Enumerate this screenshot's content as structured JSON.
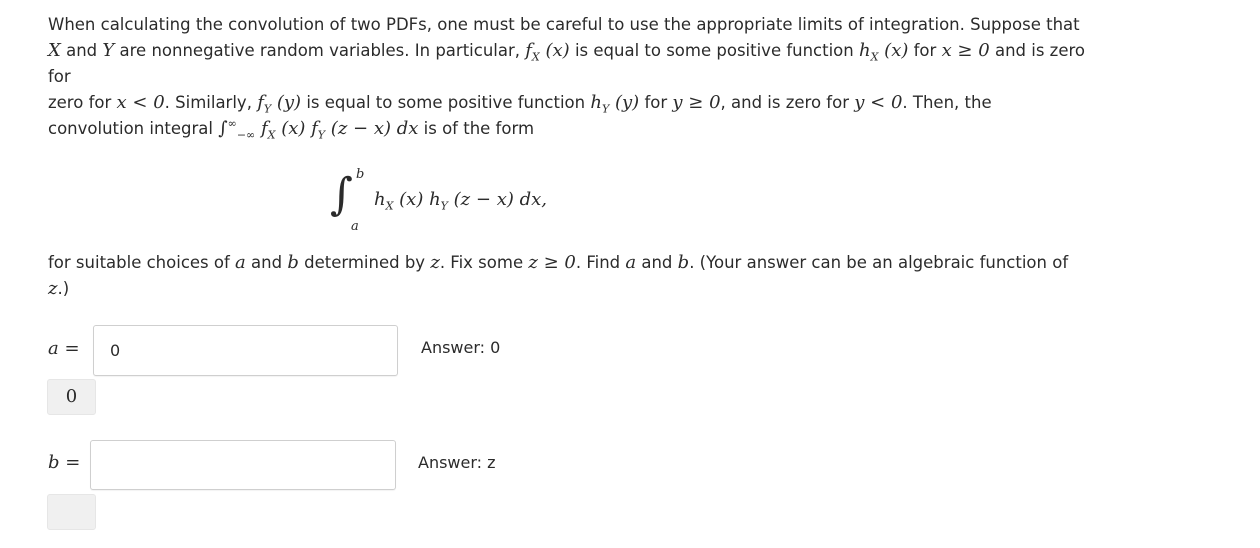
{
  "problem": {
    "p1_t1": "When calculating the convolution of two PDFs, one must be careful to use the appropriate limits of integration. Suppose that",
    "X": "X",
    "and": "and",
    "Y": "Y",
    "t2": "are nonnegative random variables. In particular,",
    "fX": "f",
    "subX": "X",
    "argx": "(x)",
    "t3": "is equal to some positive function",
    "hX": "h",
    "t4": "for",
    "cond_x": "x ≥ 0",
    "t5": "and is zero for",
    "cond_x_neg": "x < 0",
    "t6": ". Similarly,",
    "fY": "f",
    "subY": "Y",
    "argy": "(y)",
    "t7": "is equal to some positive function",
    "hY": "h",
    "t8": "for",
    "cond_y": "y ≥ 0",
    "t9": ", and is zero for",
    "cond_y_neg": "y < 0",
    "t10": ". Then, the",
    "t11": "convolution integral",
    "int_upper": "∞",
    "int_lower": "−∞",
    "integrand_short": "f",
    "argzx": "(z − x) dx",
    "t12": "is of the form"
  },
  "display": {
    "int": "∫",
    "upper": "b",
    "lower": "a",
    "integrand": "h",
    "sub1": "X",
    "arg1": " (x) h",
    "sub2": "Y",
    "arg2": " (z − x) dx,"
  },
  "para2": {
    "t1": "for suitable choices of",
    "a": "a",
    "and": "and",
    "b": "b",
    "t2": "determined by",
    "z": "z",
    "t3": ". Fix some",
    "cond": "z ≥ 0",
    "t4": ". Find",
    "t5": "and",
    "t6": ". (Your answer can be an algebraic function of",
    "t7": ".)"
  },
  "answers": {
    "a": {
      "label_var": "a",
      "label_eq": " =",
      "value": "0",
      "answer_text": "Answer: 0",
      "preview": "0"
    },
    "b": {
      "label_var": "b",
      "label_eq": " =",
      "value": "",
      "answer_text": "Answer: z",
      "preview": ""
    }
  }
}
